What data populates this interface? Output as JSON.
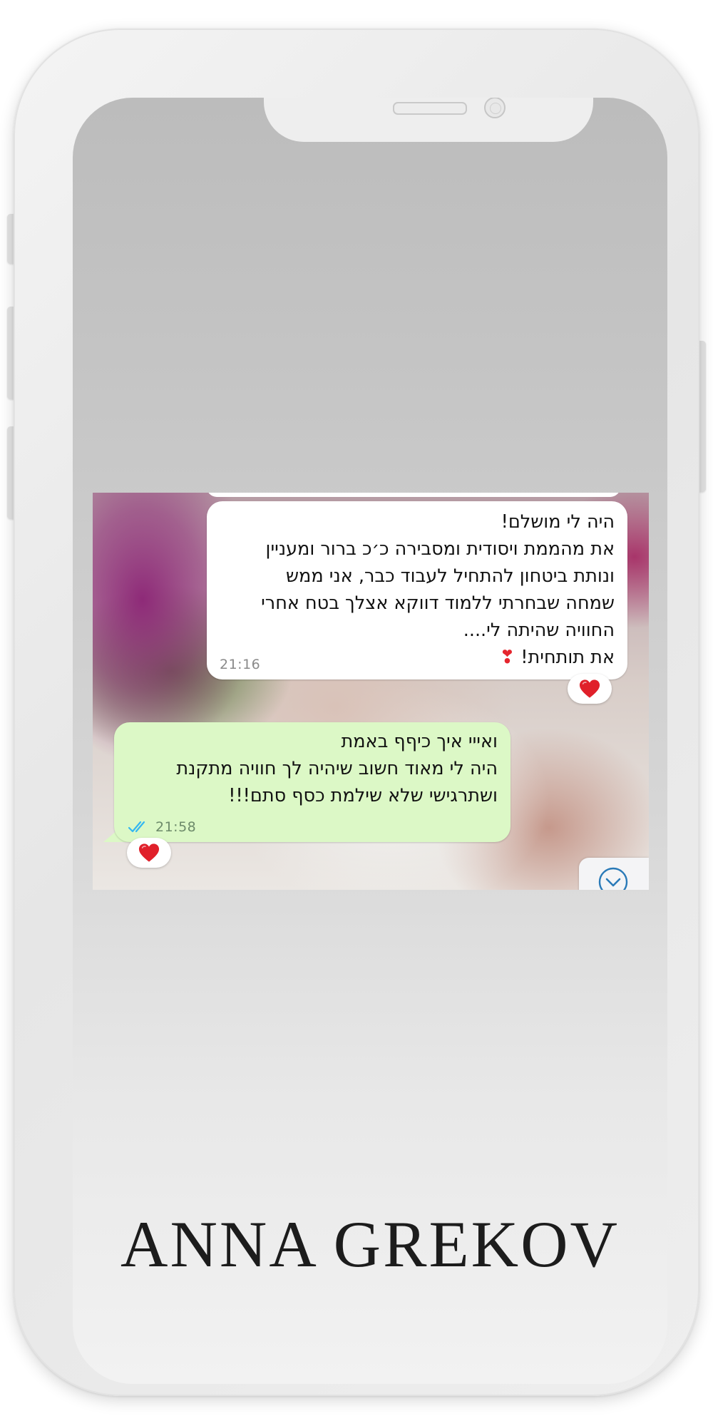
{
  "chat": {
    "incoming": {
      "lines": [
        "היה לי מושלם!",
        "את מהממת ויסודית ומסבירה כ׳כ ברור ומעניין",
        "ונותת ביטחון להתחיל לעבוד כבר, אני ממש",
        "שמחה שבחרתי ללמוד דווקא אצלך בטח אחרי",
        "החוויה שהיתה לי....",
        "את תותחית!"
      ],
      "emoji": "❣",
      "time": "21:16",
      "reaction": "heart"
    },
    "outgoing": {
      "lines": [
        "ואייי איך כיףף באמת",
        "היה לי מאוד חשוב שיהיה לך חוויה מתקנת",
        "ושתרגישי שלא שילמת כסף סתם!!!"
      ],
      "time": "21:58",
      "status": "read",
      "status_icon": "double-check-icon",
      "reaction": "heart"
    },
    "scroll_button_icon": "chevron-down-circle-icon"
  },
  "brand": {
    "name": "ANNA GREKOV"
  },
  "colors": {
    "incoming_bubble": "#ffffff",
    "outgoing_bubble": "#dcf8c6",
    "read_ticks": "#34b7f1",
    "heart": "#e0202a",
    "brand_text": "#1c1c1c"
  }
}
